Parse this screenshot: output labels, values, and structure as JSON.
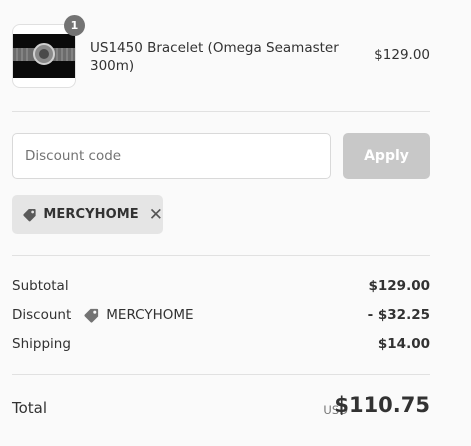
{
  "product": {
    "quantity": "1",
    "name": "US1450 Bracelet (Omega Seamaster 300m)",
    "price": "$129.00"
  },
  "discount_form": {
    "placeholder": "Discount code",
    "apply_label": "Apply"
  },
  "applied_code": {
    "code": "MERCYHOME",
    "remove_glyph": "✕"
  },
  "summary": {
    "subtotal_label": "Subtotal",
    "subtotal_value": "$129.00",
    "discount_label": "Discount",
    "discount_code": "MERCYHOME",
    "discount_value": "- $32.25",
    "shipping_label": "Shipping",
    "shipping_value": "$14.00"
  },
  "total": {
    "label": "Total",
    "currency": "USD",
    "amount": "$110.75"
  },
  "colors": {
    "background": "#fafafa",
    "apply_button_disabled": "#c8c8c8",
    "tag_background": "#e5e5e5",
    "badge": "#737373"
  }
}
